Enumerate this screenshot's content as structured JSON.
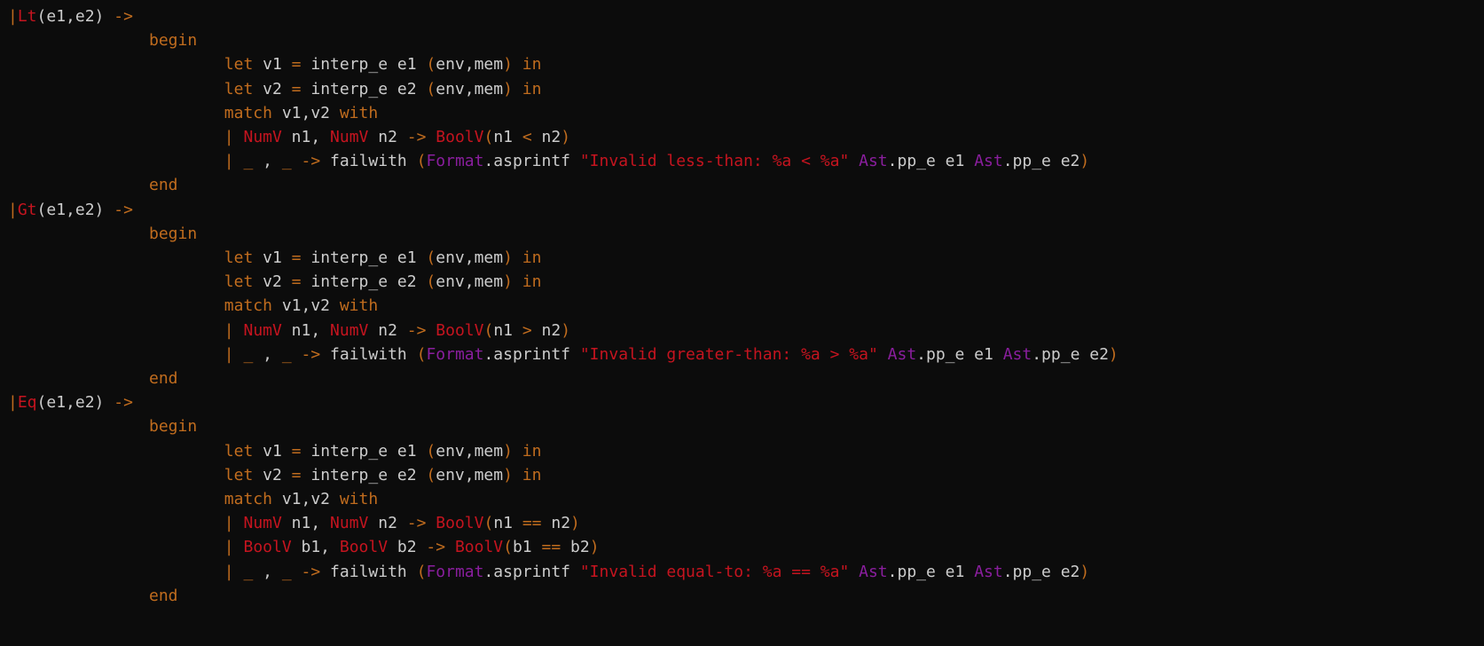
{
  "colors": {
    "background": "#0c0c0c",
    "default": "#cccccc",
    "keyword": "#c06c1e",
    "constructor": "#c5141f",
    "string": "#c5141f",
    "module": "#8a1e9e"
  },
  "lines": [
    {
      "indent": 0,
      "tokens": [
        [
          "kw",
          "|"
        ],
        [
          "ctor",
          "Lt"
        ],
        [
          "id",
          "(e1,e2) "
        ],
        [
          "op",
          "->"
        ]
      ]
    },
    {
      "indent": 15,
      "tokens": [
        [
          "kw",
          "begin"
        ]
      ]
    },
    {
      "indent": 23,
      "tokens": [
        [
          "kw",
          "let"
        ],
        [
          "id",
          " v1 "
        ],
        [
          "op",
          "="
        ],
        [
          "id",
          " interp_e e1 "
        ],
        [
          "paren",
          "("
        ],
        [
          "id",
          "env,mem"
        ],
        [
          "paren",
          ")"
        ],
        [
          "id",
          " "
        ],
        [
          "kw",
          "in"
        ]
      ]
    },
    {
      "indent": 23,
      "tokens": [
        [
          "kw",
          "let"
        ],
        [
          "id",
          " v2 "
        ],
        [
          "op",
          "="
        ],
        [
          "id",
          " interp_e e2 "
        ],
        [
          "paren",
          "("
        ],
        [
          "id",
          "env,mem"
        ],
        [
          "paren",
          ")"
        ],
        [
          "id",
          " "
        ],
        [
          "kw",
          "in"
        ]
      ]
    },
    {
      "indent": 23,
      "tokens": [
        [
          "kw",
          "match"
        ],
        [
          "id",
          " v1,v2 "
        ],
        [
          "kw",
          "with"
        ]
      ]
    },
    {
      "indent": 23,
      "tokens": [
        [
          "kw",
          "|"
        ],
        [
          "id",
          " "
        ],
        [
          "ctor",
          "NumV"
        ],
        [
          "id",
          " n1, "
        ],
        [
          "ctor",
          "NumV"
        ],
        [
          "id",
          " n2 "
        ],
        [
          "op",
          "->"
        ],
        [
          "id",
          " "
        ],
        [
          "ctor",
          "BoolV"
        ],
        [
          "paren",
          "("
        ],
        [
          "id",
          "n1 "
        ],
        [
          "op",
          "<"
        ],
        [
          "id",
          " n2"
        ],
        [
          "paren",
          ")"
        ]
      ]
    },
    {
      "indent": 23,
      "tokens": [
        [
          "kw",
          "|"
        ],
        [
          "id",
          " "
        ],
        [
          "kw",
          "_"
        ],
        [
          "id",
          " , "
        ],
        [
          "kw",
          "_"
        ],
        [
          "id",
          " "
        ],
        [
          "op",
          "->"
        ],
        [
          "id",
          " failwith "
        ],
        [
          "paren",
          "("
        ],
        [
          "mod",
          "Format"
        ],
        [
          "id",
          ".asprintf "
        ],
        [
          "str",
          "\"Invalid less-than: %a < %a\""
        ],
        [
          "id",
          " "
        ],
        [
          "mod",
          "Ast"
        ],
        [
          "id",
          ".pp_e e1 "
        ],
        [
          "mod",
          "Ast"
        ],
        [
          "id",
          ".pp_e e2"
        ],
        [
          "paren",
          ")"
        ]
      ]
    },
    {
      "indent": 15,
      "tokens": [
        [
          "kw",
          "end"
        ]
      ]
    },
    {
      "indent": 0,
      "tokens": [
        [
          "kw",
          "|"
        ],
        [
          "ctor",
          "Gt"
        ],
        [
          "id",
          "(e1,e2) "
        ],
        [
          "op",
          "->"
        ]
      ]
    },
    {
      "indent": 15,
      "tokens": [
        [
          "kw",
          "begin"
        ]
      ]
    },
    {
      "indent": 23,
      "tokens": [
        [
          "kw",
          "let"
        ],
        [
          "id",
          " v1 "
        ],
        [
          "op",
          "="
        ],
        [
          "id",
          " interp_e e1 "
        ],
        [
          "paren",
          "("
        ],
        [
          "id",
          "env,mem"
        ],
        [
          "paren",
          ")"
        ],
        [
          "id",
          " "
        ],
        [
          "kw",
          "in"
        ]
      ]
    },
    {
      "indent": 23,
      "tokens": [
        [
          "kw",
          "let"
        ],
        [
          "id",
          " v2 "
        ],
        [
          "op",
          "="
        ],
        [
          "id",
          " interp_e e2 "
        ],
        [
          "paren",
          "("
        ],
        [
          "id",
          "env,mem"
        ],
        [
          "paren",
          ")"
        ],
        [
          "id",
          " "
        ],
        [
          "kw",
          "in"
        ]
      ]
    },
    {
      "indent": 23,
      "tokens": [
        [
          "kw",
          "match"
        ],
        [
          "id",
          " v1,v2 "
        ],
        [
          "kw",
          "with"
        ]
      ]
    },
    {
      "indent": 23,
      "tokens": [
        [
          "kw",
          "|"
        ],
        [
          "id",
          " "
        ],
        [
          "ctor",
          "NumV"
        ],
        [
          "id",
          " n1, "
        ],
        [
          "ctor",
          "NumV"
        ],
        [
          "id",
          " n2 "
        ],
        [
          "op",
          "->"
        ],
        [
          "id",
          " "
        ],
        [
          "ctor",
          "BoolV"
        ],
        [
          "paren",
          "("
        ],
        [
          "id",
          "n1 "
        ],
        [
          "op",
          ">"
        ],
        [
          "id",
          " n2"
        ],
        [
          "paren",
          ")"
        ]
      ]
    },
    {
      "indent": 23,
      "tokens": [
        [
          "kw",
          "|"
        ],
        [
          "id",
          " "
        ],
        [
          "kw",
          "_"
        ],
        [
          "id",
          " , "
        ],
        [
          "kw",
          "_"
        ],
        [
          "id",
          " "
        ],
        [
          "op",
          "->"
        ],
        [
          "id",
          " failwith "
        ],
        [
          "paren",
          "("
        ],
        [
          "mod",
          "Format"
        ],
        [
          "id",
          ".asprintf "
        ],
        [
          "str",
          "\"Invalid greater-than: %a > %a\""
        ],
        [
          "id",
          " "
        ],
        [
          "mod",
          "Ast"
        ],
        [
          "id",
          ".pp_e e1 "
        ],
        [
          "mod",
          "Ast"
        ],
        [
          "id",
          ".pp_e e2"
        ],
        [
          "paren",
          ")"
        ]
      ]
    },
    {
      "indent": 15,
      "tokens": [
        [
          "kw",
          "end"
        ]
      ]
    },
    {
      "indent": 0,
      "tokens": [
        [
          "kw",
          "|"
        ],
        [
          "ctor",
          "Eq"
        ],
        [
          "id",
          "(e1,e2) "
        ],
        [
          "op",
          "->"
        ]
      ]
    },
    {
      "indent": 15,
      "tokens": [
        [
          "kw",
          "begin"
        ]
      ]
    },
    {
      "indent": 23,
      "tokens": [
        [
          "kw",
          "let"
        ],
        [
          "id",
          " v1 "
        ],
        [
          "op",
          "="
        ],
        [
          "id",
          " interp_e e1 "
        ],
        [
          "paren",
          "("
        ],
        [
          "id",
          "env,mem"
        ],
        [
          "paren",
          ")"
        ],
        [
          "id",
          " "
        ],
        [
          "kw",
          "in"
        ]
      ]
    },
    {
      "indent": 23,
      "tokens": [
        [
          "kw",
          "let"
        ],
        [
          "id",
          " v2 "
        ],
        [
          "op",
          "="
        ],
        [
          "id",
          " interp_e e2 "
        ],
        [
          "paren",
          "("
        ],
        [
          "id",
          "env,mem"
        ],
        [
          "paren",
          ")"
        ],
        [
          "id",
          " "
        ],
        [
          "kw",
          "in"
        ]
      ]
    },
    {
      "indent": 23,
      "tokens": [
        [
          "kw",
          "match"
        ],
        [
          "id",
          " v1,v2 "
        ],
        [
          "kw",
          "with"
        ]
      ]
    },
    {
      "indent": 23,
      "tokens": [
        [
          "kw",
          "|"
        ],
        [
          "id",
          " "
        ],
        [
          "ctor",
          "NumV"
        ],
        [
          "id",
          " n1, "
        ],
        [
          "ctor",
          "NumV"
        ],
        [
          "id",
          " n2 "
        ],
        [
          "op",
          "->"
        ],
        [
          "id",
          " "
        ],
        [
          "ctor",
          "BoolV"
        ],
        [
          "paren",
          "("
        ],
        [
          "id",
          "n1 "
        ],
        [
          "op",
          "=="
        ],
        [
          "id",
          " n2"
        ],
        [
          "paren",
          ")"
        ]
      ]
    },
    {
      "indent": 23,
      "tokens": [
        [
          "kw",
          "|"
        ],
        [
          "id",
          " "
        ],
        [
          "ctor",
          "BoolV"
        ],
        [
          "id",
          " b1, "
        ],
        [
          "ctor",
          "BoolV"
        ],
        [
          "id",
          " b2 "
        ],
        [
          "op",
          "->"
        ],
        [
          "id",
          " "
        ],
        [
          "ctor",
          "BoolV"
        ],
        [
          "paren",
          "("
        ],
        [
          "id",
          "b1 "
        ],
        [
          "op",
          "=="
        ],
        [
          "id",
          " b2"
        ],
        [
          "paren",
          ")"
        ]
      ]
    },
    {
      "indent": 23,
      "tokens": [
        [
          "kw",
          "|"
        ],
        [
          "id",
          " "
        ],
        [
          "kw",
          "_"
        ],
        [
          "id",
          " , "
        ],
        [
          "kw",
          "_"
        ],
        [
          "id",
          " "
        ],
        [
          "op",
          "->"
        ],
        [
          "id",
          " failwith "
        ],
        [
          "paren",
          "("
        ],
        [
          "mod",
          "Format"
        ],
        [
          "id",
          ".asprintf "
        ],
        [
          "str",
          "\"Invalid equal-to: %a == %a\""
        ],
        [
          "id",
          " "
        ],
        [
          "mod",
          "Ast"
        ],
        [
          "id",
          ".pp_e e1 "
        ],
        [
          "mod",
          "Ast"
        ],
        [
          "id",
          ".pp_e e2"
        ],
        [
          "paren",
          ")"
        ]
      ]
    },
    {
      "indent": 15,
      "tokens": [
        [
          "kw",
          "end"
        ]
      ]
    }
  ]
}
